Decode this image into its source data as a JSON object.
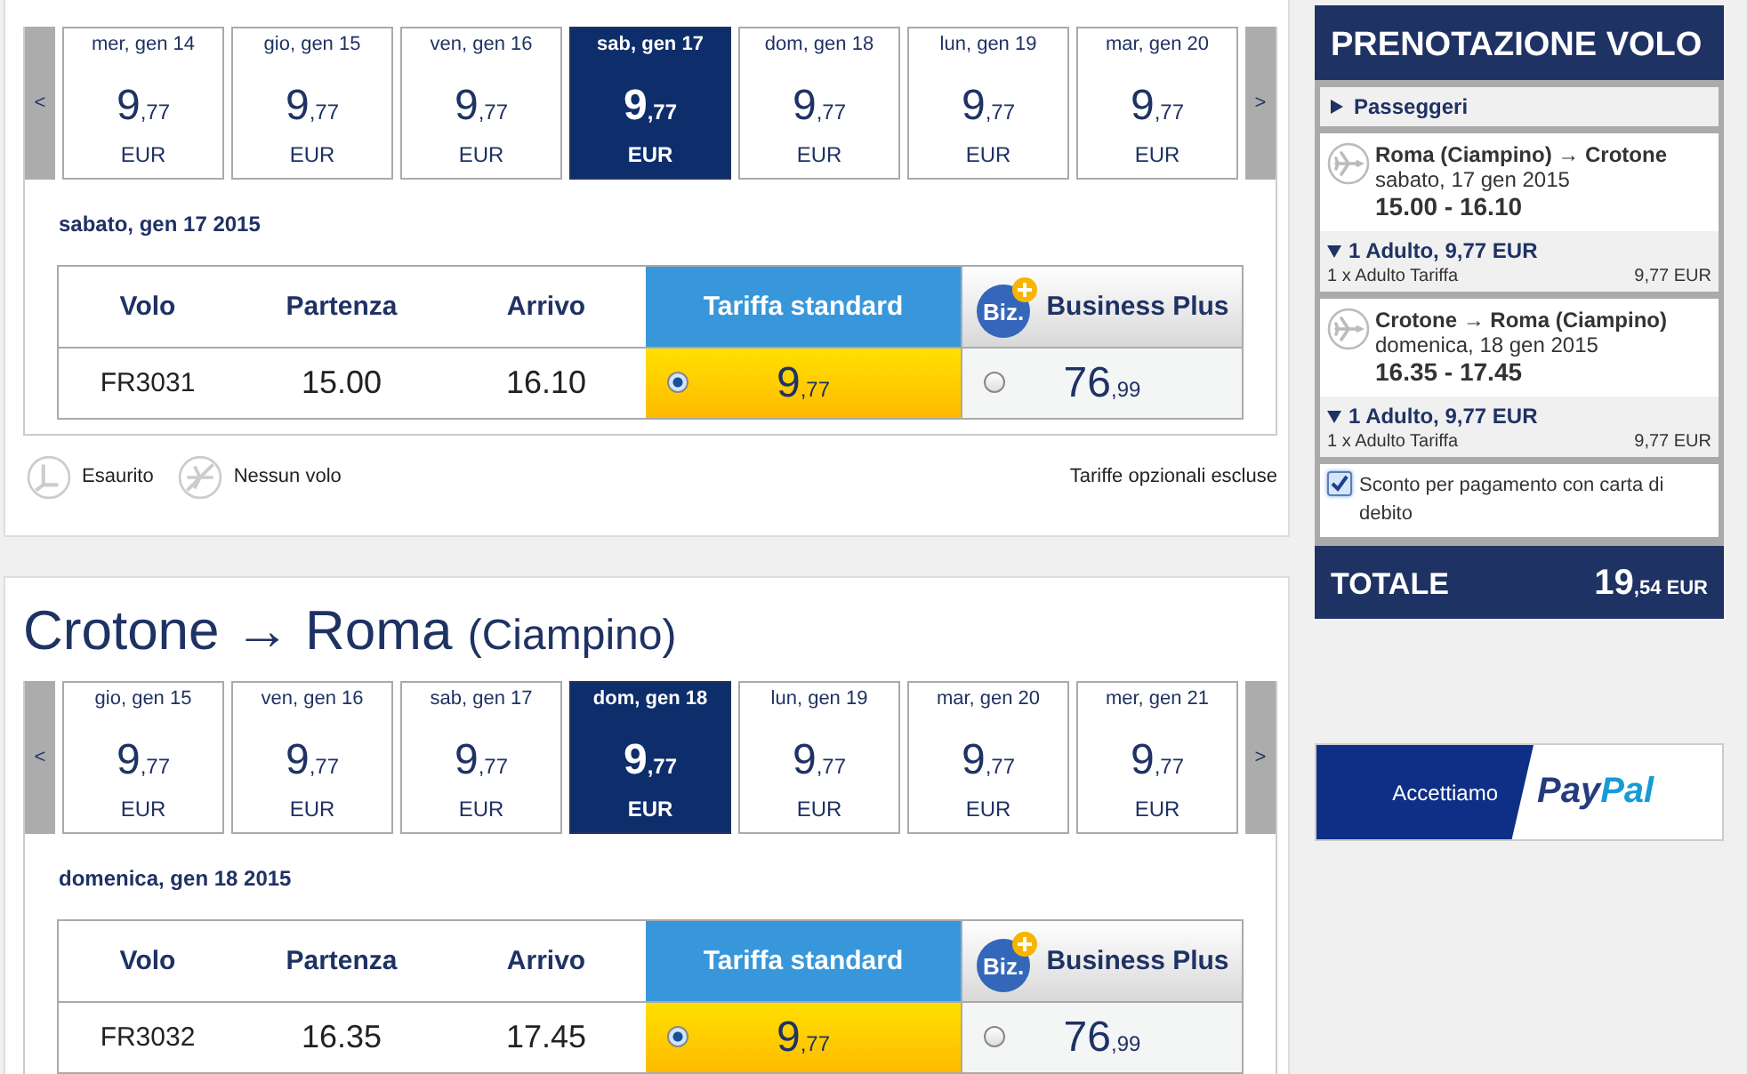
{
  "journeys": [
    {
      "prev": "<",
      "next": ">",
      "dates": [
        {
          "label": "mer, gen 14",
          "main": "9",
          "cents": ",77",
          "currency": "EUR",
          "selected": false
        },
        {
          "label": "gio, gen 15",
          "main": "9",
          "cents": ",77",
          "currency": "EUR",
          "selected": false
        },
        {
          "label": "ven, gen 16",
          "main": "9",
          "cents": ",77",
          "currency": "EUR",
          "selected": false
        },
        {
          "label": "sab, gen 17",
          "main": "9",
          "cents": ",77",
          "currency": "EUR",
          "selected": true
        },
        {
          "label": "dom, gen 18",
          "main": "9",
          "cents": ",77",
          "currency": "EUR",
          "selected": false
        },
        {
          "label": "lun, gen 19",
          "main": "9",
          "cents": ",77",
          "currency": "EUR",
          "selected": false
        },
        {
          "label": "mar, gen 20",
          "main": "9",
          "cents": ",77",
          "currency": "EUR",
          "selected": false
        }
      ],
      "day": "sabato, gen 17 2015",
      "columns": [
        "Volo",
        "Partenza",
        "Arrivo",
        "Tariffa standard",
        "Business Plus"
      ],
      "badge": "Biz.",
      "row": {
        "flight": "FR3031",
        "departure": "15.00",
        "arrival": "16.10",
        "fares": [
          {
            "main": "9",
            "cents": ",77",
            "selected": true
          },
          {
            "main": "76",
            "cents": ",99",
            "selected": false
          }
        ]
      },
      "legend": [
        "Esaurito",
        "Nessun volo"
      ],
      "note": "Tariffe opzionali escluse"
    },
    {
      "title": {
        "route": "Crotone → Roma",
        "airport": "(Ciampino)"
      },
      "prev": "<",
      "next": ">",
      "dates": [
        {
          "label": "gio, gen 15",
          "main": "9",
          "cents": ",77",
          "currency": "EUR",
          "selected": false
        },
        {
          "label": "ven, gen 16",
          "main": "9",
          "cents": ",77",
          "currency": "EUR",
          "selected": false
        },
        {
          "label": "sab, gen 17",
          "main": "9",
          "cents": ",77",
          "currency": "EUR",
          "selected": false
        },
        {
          "label": "dom, gen 18",
          "main": "9",
          "cents": ",77",
          "currency": "EUR",
          "selected": true
        },
        {
          "label": "lun, gen 19",
          "main": "9",
          "cents": ",77",
          "currency": "EUR",
          "selected": false
        },
        {
          "label": "mar, gen 20",
          "main": "9",
          "cents": ",77",
          "currency": "EUR",
          "selected": false
        },
        {
          "label": "mer, gen 21",
          "main": "9",
          "cents": ",77",
          "currency": "EUR",
          "selected": false
        }
      ],
      "day": "domenica, gen 18 2015",
      "columns": [
        "Volo",
        "Partenza",
        "Arrivo",
        "Tariffa standard",
        "Business Plus"
      ],
      "badge": "Biz.",
      "row": {
        "flight": "FR3032",
        "departure": "16.35",
        "arrival": "17.45",
        "fares": [
          {
            "main": "9",
            "cents": ",77",
            "selected": true
          },
          {
            "main": "76",
            "cents": ",99",
            "selected": false
          }
        ]
      }
    }
  ],
  "booking": {
    "title": "PRENOTAZIONE VOLO",
    "passengers": {
      "label": "Passeggeri",
      "expanded": false
    },
    "flights": [
      {
        "route": "Roma (Ciampino) → Crotone",
        "date": "sabato, 17 gen 2015",
        "times": "15.00 - 16.10",
        "fare": {
          "label": "1 Adulto, 9,77 EUR",
          "expanded": true
        },
        "line": {
          "label": "1 x Adulto Tariffa",
          "amount": "9,77 EUR"
        }
      },
      {
        "route": "Crotone → Roma (Ciampino)",
        "date": "domenica, 18 gen 2015",
        "times": "16.35 - 17.45",
        "fare": {
          "label": "1 Adulto, 9,77 EUR",
          "expanded": true
        },
        "line": {
          "label": "1 x Adulto Tariffa",
          "amount": "9,77 EUR"
        }
      }
    ],
    "discount": {
      "label": "Sconto per pagamento con carta di debito",
      "checked": true
    },
    "total": {
      "label": "TOTALE",
      "main": "19",
      "cents": ",54 EUR"
    }
  },
  "paypal": {
    "text": "Accettiamo",
    "brand_a": "Pay",
    "brand_b": "Pal"
  }
}
